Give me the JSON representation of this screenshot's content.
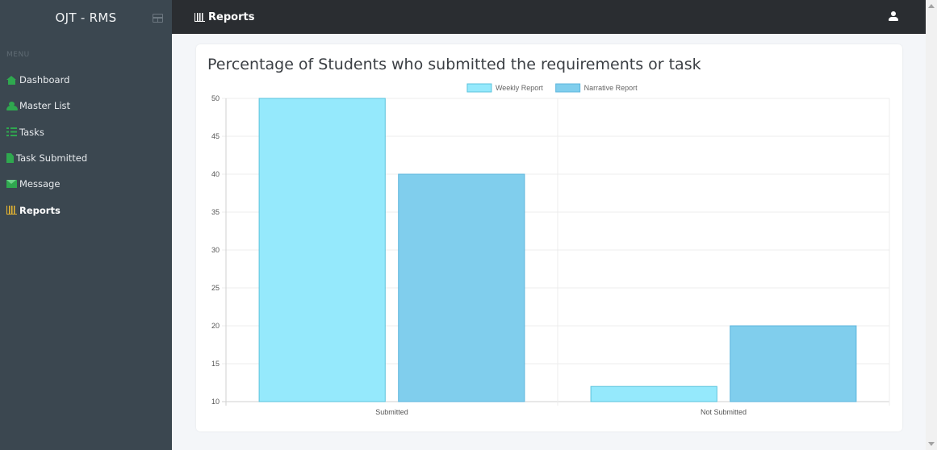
{
  "sidebar": {
    "brand": "OJT - RMS",
    "menu_heading": "MENU",
    "items": [
      {
        "label": "Dashboard",
        "icon": "home-icon",
        "active": false
      },
      {
        "label": "Master List",
        "icon": "users-icon",
        "active": false
      },
      {
        "label": "Tasks",
        "icon": "tasks-icon",
        "active": false
      },
      {
        "label": "Task Submitted",
        "icon": "file-icon",
        "active": false
      },
      {
        "label": "Message",
        "icon": "envelope-icon",
        "active": false
      },
      {
        "label": "Reports",
        "icon": "bar-chart-icon",
        "active": true
      }
    ],
    "colors": {
      "background": "#3b4750",
      "icon_green": "#2fa84f",
      "icon_active": "#e9b730"
    }
  },
  "topbar": {
    "title": "Reports",
    "title_icon": "bar-chart-icon",
    "user_icon": "user-icon"
  },
  "card": {
    "title": "Percentage of Students who submitted the requirements or task"
  },
  "chart_data": {
    "type": "bar",
    "title": "Percentage of Students who submitted the requirements or task",
    "categories": [
      "Submitted",
      "Not Submitted"
    ],
    "series": [
      {
        "name": "Weekly Report",
        "values": [
          50,
          12
        ],
        "fill": "#95e9fc",
        "stroke": "#5bc3dc"
      },
      {
        "name": "Narrative Report",
        "values": [
          40,
          20
        ],
        "fill": "#80ceed",
        "stroke": "#5cb6dd"
      }
    ],
    "ylim": [
      10,
      50
    ],
    "yticks": [
      10,
      15,
      20,
      25,
      30,
      35,
      40,
      45,
      50
    ],
    "xlabel": "",
    "ylabel": "",
    "grid": true,
    "legend": "top-center"
  }
}
